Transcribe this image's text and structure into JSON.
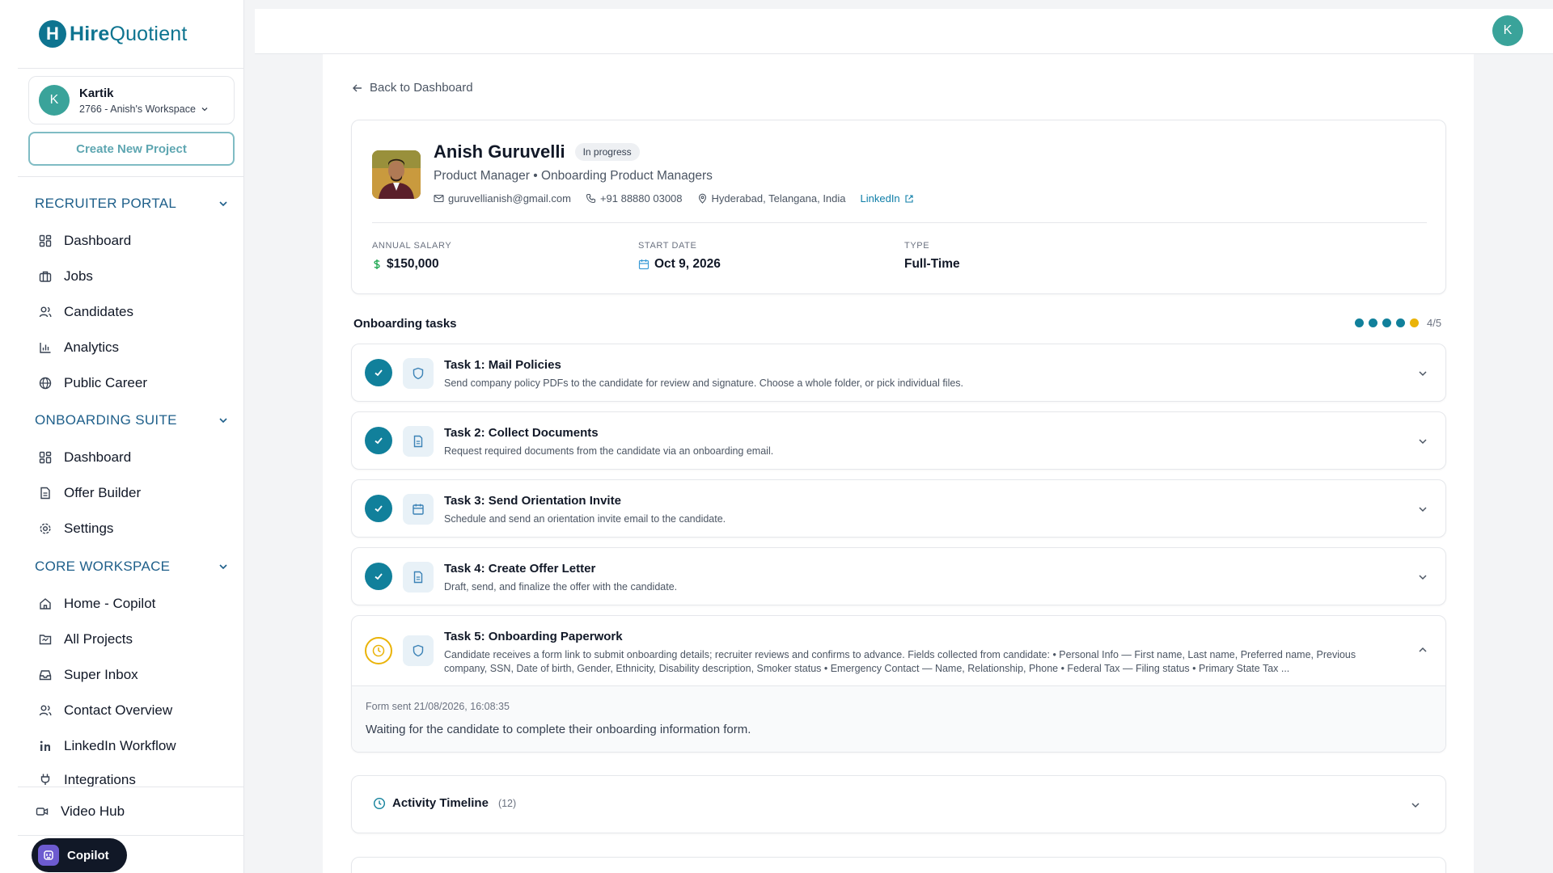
{
  "brand": {
    "prefix": "Hire",
    "suffix": "Quotient",
    "mark": "H"
  },
  "workspace": {
    "avatar": "K",
    "name": "Kartik",
    "sub": "2766 - Anish's Workspace"
  },
  "create_project_label": "Create New Project",
  "sections": [
    {
      "title": "RECRUITER PORTAL",
      "items": [
        "Dashboard",
        "Jobs",
        "Candidates",
        "Analytics",
        "Public Career"
      ]
    },
    {
      "title": "ONBOARDING SUITE",
      "items": [
        "Dashboard",
        "Offer Builder",
        "Settings"
      ]
    },
    {
      "title": "CORE WORKSPACE",
      "items": [
        "Home - Copilot",
        "All Projects",
        "Super Inbox",
        "Contact Overview",
        "LinkedIn Workflow",
        "Integrations"
      ]
    }
  ],
  "video_hub": "Video Hub",
  "copilot_label": "Copilot",
  "top_avatar": "K",
  "back_label": "Back to Dashboard",
  "candidate": {
    "name": "Anish Guruvelli",
    "status": "In progress",
    "role": "Product Manager • Onboarding Product Managers",
    "email": "guruvellianish@gmail.com",
    "phone": "+91 88880 03008",
    "location": "Hyderabad, Telangana, India",
    "linkedin": "LinkedIn"
  },
  "meta": [
    {
      "label": "ANNUAL SALARY",
      "value": "$150,000"
    },
    {
      "label": "START DATE",
      "value": "Oct 9, 2026"
    },
    {
      "label": "TYPE",
      "value": "Full-Time"
    }
  ],
  "tasks_title": "Onboarding tasks",
  "progress": {
    "done": 4,
    "total": 5,
    "label": "4/5"
  },
  "tasks": [
    {
      "title": "Task 1: Mail Policies",
      "desc": "Send company policy PDFs to the candidate for review and signature. Choose a whole folder, or pick individual files.",
      "icon": "shield-icon",
      "status": "done"
    },
    {
      "title": "Task 2: Collect Documents",
      "desc": "Request required documents from the candidate via an onboarding email.",
      "icon": "document-icon",
      "status": "done"
    },
    {
      "title": "Task 3: Send Orientation Invite",
      "desc": "Schedule and send an orientation invite email to the candidate.",
      "icon": "calendar-icon",
      "status": "done"
    },
    {
      "title": "Task 4: Create Offer Letter",
      "desc": "Draft, send, and finalize the offer with the candidate.",
      "icon": "document-icon",
      "status": "done"
    },
    {
      "title": "Task 5: Onboarding Paperwork",
      "desc": "Candidate receives a form link to submit onboarding details; recruiter reviews and confirms to advance. Fields collected from candidate: • Personal Info — First name, Last name, Preferred name, Previous company, SSN, Date of birth, Gender, Ethnicity, Disability description, Smoker status • Emergency Contact — Name, Relationship, Phone • Federal Tax — Filing status • Primary State Tax ...",
      "icon": "shield-icon",
      "status": "pending",
      "form_sent": "Form sent 21/08/2026, 16:08:35",
      "waiting": "Waiting for the candidate to complete their onboarding information form."
    }
  ],
  "timeline": {
    "title": "Activity Timeline",
    "count": "(12)"
  },
  "colors": {
    "accent": "#11809b",
    "pending": "#eab308",
    "section": "#1e5f8a"
  }
}
